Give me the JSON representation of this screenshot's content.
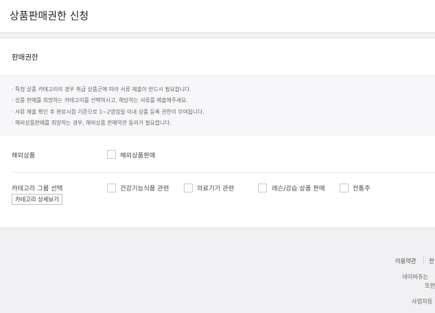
{
  "header": {
    "title": "상품판매권한 신청"
  },
  "section": {
    "title": "판매권한",
    "notices": [
      "특정 상품 카테고리의 경우 취급 상품군에 따라 서류 제출이 반드시 필요합니다.",
      "상품 판매를 희망하는 카테고리를 선택하시고, 해당하는 서류를 제출해주세요.",
      "서류 제출 확인 후 완료시점 기준으로 1~2영업일 이내 상품 등록 권한이 부여됩니다.",
      "해외상품판매를 희망하는 경우, 해외상품 판매약관 동의가 필요합니다."
    ],
    "overseas": {
      "label": "해외상품",
      "option": "해외상품판매"
    },
    "category": {
      "label": "카테고리 그룹 선택",
      "detail_button": "카테고리 상세보기",
      "options": [
        "건강기능식품 관련",
        "의료기기 관련",
        "레슨/강습 상품 판매",
        "전통주"
      ]
    }
  },
  "footer": {
    "link_terms": "이용약관",
    "link_next": "전",
    "line1": "네이버쥬는",
    "line2": "또한",
    "line3": "사업자등"
  }
}
